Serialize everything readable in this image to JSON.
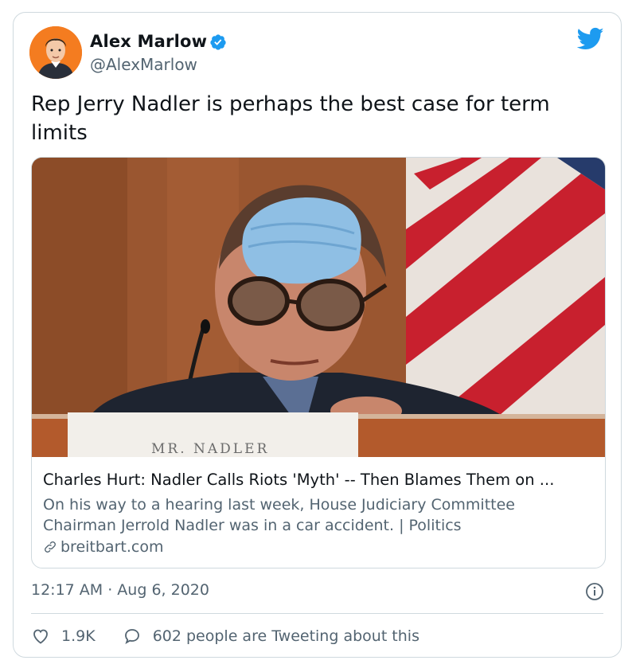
{
  "tweet": {
    "author_name": "Alex Marlow",
    "author_handle": "@AlexMarlow",
    "text": "Rep Jerry Nadler is perhaps the best case for term limits",
    "timestamp": "12:17 AM · Aug 6, 2020",
    "likes": "1.9K",
    "conversation": "602 people are Tweeting about this"
  },
  "link_card": {
    "placard_text": "MR. NADLER",
    "title": "Charles Hurt: Nadler Calls Riots 'Myth' -- Then Blames Them on ...",
    "description": "On his way to a hearing last week, House Judiciary Committee Chairman Jerrold Nadler was in a car accident. | Politics",
    "domain": "breitbart.com"
  },
  "icons": {
    "verified": "verified-badge-icon",
    "brand": "twitter-bird-icon",
    "link": "link-icon",
    "info": "info-icon",
    "like": "heart-icon",
    "reply": "speech-bubble-icon"
  },
  "colors": {
    "accent": "#1d9bf0",
    "secondary_text": "#536471",
    "border": "#cfd9de",
    "avatar_bg": "#f47c20"
  }
}
